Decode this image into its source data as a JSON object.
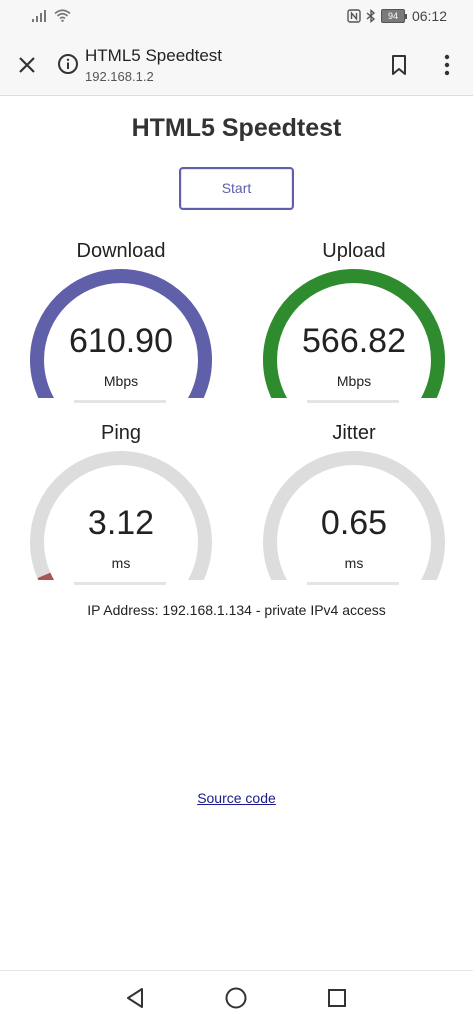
{
  "statusbar": {
    "battery": "94",
    "time": "06:12",
    "icons": [
      "signal-icon",
      "wifi-icon",
      "nfc-icon",
      "bluetooth-icon",
      "battery-icon"
    ]
  },
  "browser": {
    "title": "HTML5 Speedtest",
    "url": "192.168.1.2",
    "icons": [
      "close-icon",
      "info-icon",
      "bookmark-icon",
      "more-vertical-icon"
    ]
  },
  "page": {
    "title": "HTML5 Speedtest",
    "start_label": "Start",
    "ip_info": "IP Address: 192.168.1.134 - private IPv4 access",
    "source_link": "Source code"
  },
  "gauges": {
    "download": {
      "label": "Download",
      "value": "610.90",
      "unit": "Mbps",
      "fill": 1.0,
      "color": "#6060aa"
    },
    "upload": {
      "label": "Upload",
      "value": "566.82",
      "unit": "Mbps",
      "fill": 1.0,
      "color": "#2e8b2e"
    },
    "ping": {
      "label": "Ping",
      "value": "3.12",
      "unit": "ms",
      "fill": 0.08,
      "color": "#aa5555"
    },
    "jitter": {
      "label": "Jitter",
      "value": "0.65",
      "unit": "ms",
      "fill": 0.04,
      "color": "#aa5555"
    }
  },
  "colors": {
    "track": "#dddddd",
    "accent": "#6060aa"
  },
  "navbar": {
    "icons": [
      "back-icon",
      "home-icon",
      "recents-icon"
    ]
  }
}
